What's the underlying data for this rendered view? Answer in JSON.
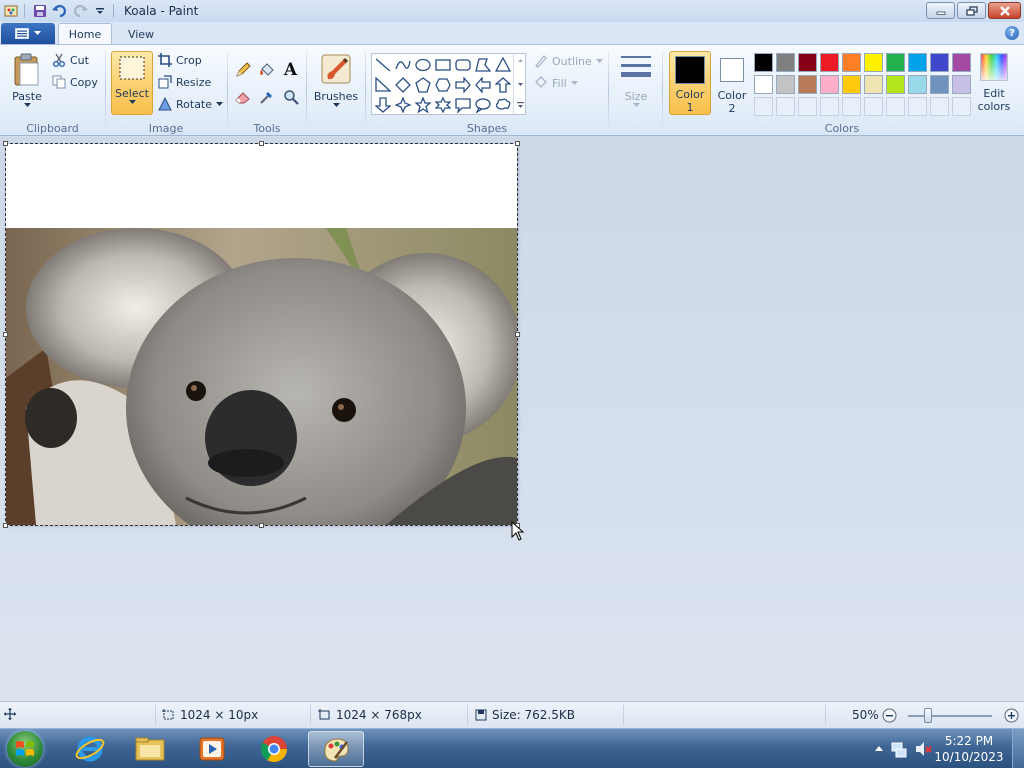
{
  "window": {
    "title": "Koala - Paint",
    "minimize_icon": "minimize-icon",
    "restore_icon": "restore-icon",
    "close_icon": "close-icon"
  },
  "tabs": [
    {
      "label": "Home",
      "active": true
    },
    {
      "label": "View",
      "active": false
    }
  ],
  "help_label": "?",
  "ribbon": {
    "clipboard": {
      "label": "Clipboard",
      "paste": "Paste",
      "cut": "Cut",
      "copy": "Copy"
    },
    "image": {
      "label": "Image",
      "select": "Select",
      "crop": "Crop",
      "resize": "Resize",
      "rotate": "Rotate"
    },
    "tools": {
      "label": "Tools",
      "items": [
        "pencil-icon",
        "fill-icon",
        "text-icon",
        "eraser-icon",
        "color-picker-icon",
        "magnifier-icon"
      ],
      "text_glyph": "A"
    },
    "brushes": {
      "label": "Brushes"
    },
    "shapes": {
      "label": "Shapes",
      "outline": "Outline",
      "fill": "Fill"
    },
    "size": {
      "label": "Size"
    },
    "colors": {
      "label": "Colors",
      "color1_label": "Color",
      "color1_num": "1",
      "color2_label": "Color",
      "color2_num": "2",
      "color1_value": "#000000",
      "color2_value": "#ffffff",
      "edit_label": "Edit",
      "edit_label2": "colors",
      "palette_row1": [
        "#000000",
        "#7f7f7f",
        "#880015",
        "#ed1c24",
        "#ff7f27",
        "#fff200",
        "#22b14c",
        "#00a2e8",
        "#3f48cc",
        "#a349a4"
      ],
      "palette_row2": [
        "#ffffff",
        "#c3c3c3",
        "#b97a57",
        "#ffaec9",
        "#ffc90e",
        "#efe4b0",
        "#b5e61d",
        "#99d9ea",
        "#7092be",
        "#c8bfe7"
      ]
    }
  },
  "status": {
    "selection_size": "1024 × 10px",
    "image_size": "1024 × 768px",
    "file_size": "Size: 762.5KB",
    "zoom": "50%"
  },
  "taskbar": {
    "apps": [
      "internet-explorer-icon",
      "file-explorer-icon",
      "media-player-icon",
      "chrome-icon",
      "paint-icon"
    ],
    "time": "5:22 PM",
    "date": "10/10/2023"
  }
}
